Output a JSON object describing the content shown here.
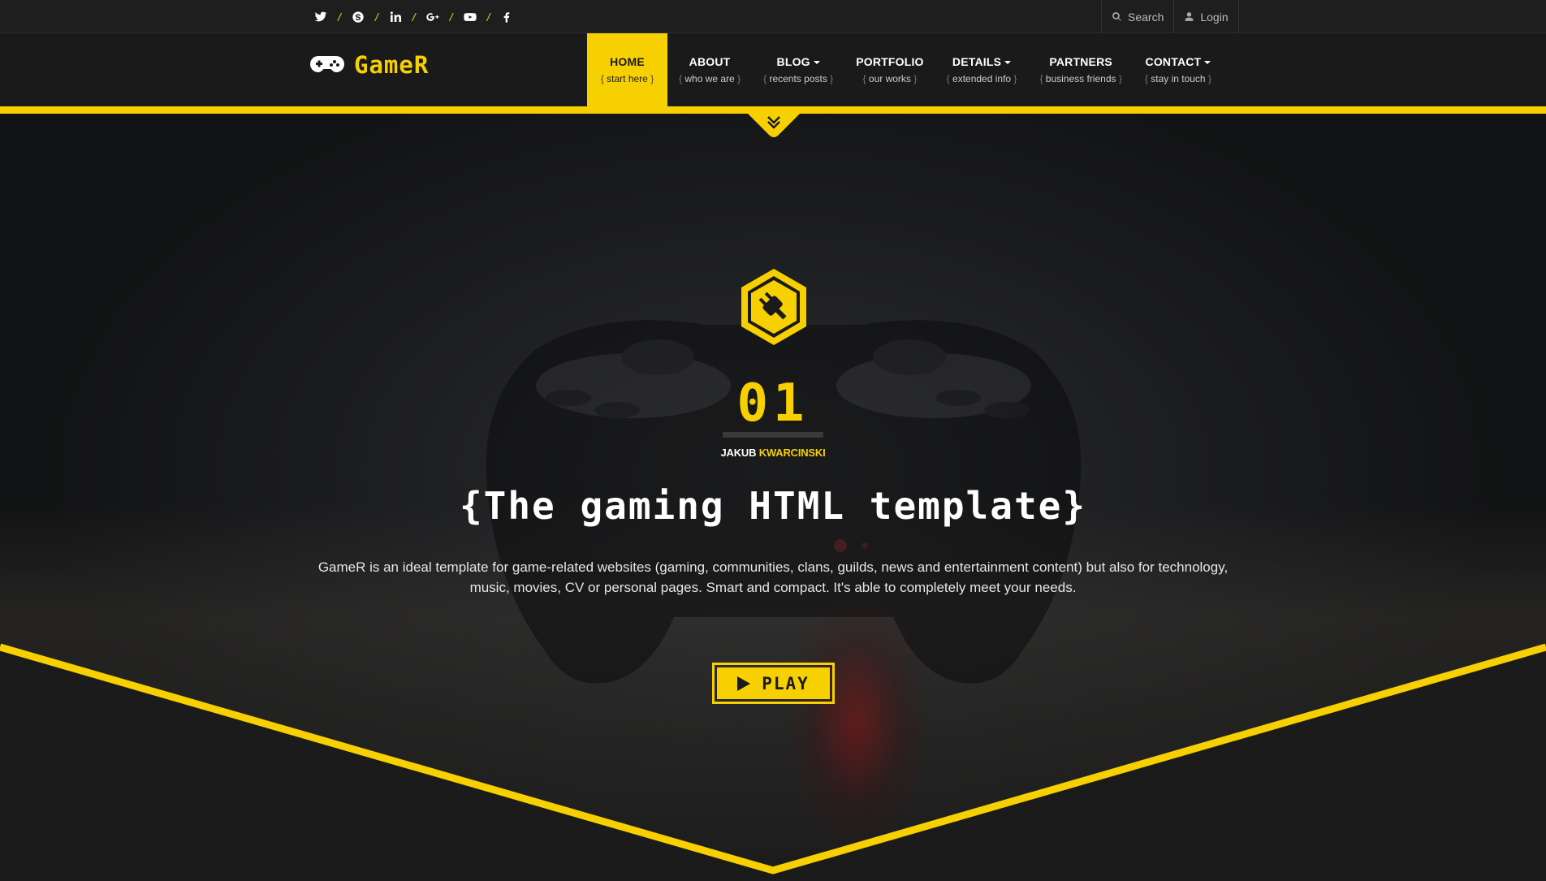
{
  "topbar": {
    "social_icons": [
      "twitter-icon",
      "skype-icon",
      "linkedin-icon",
      "google-plus-icon",
      "youtube-icon",
      "facebook-icon"
    ],
    "separator": "/",
    "search_label": "Search",
    "login_label": "Login"
  },
  "logo": {
    "text_main": "Game",
    "text_end": "R"
  },
  "nav": {
    "items": [
      {
        "label": "HOME",
        "sub": "start here",
        "active": true,
        "dropdown": false
      },
      {
        "label": "ABOUT",
        "sub": "who we are",
        "active": false,
        "dropdown": false
      },
      {
        "label": "BLOG",
        "sub": "recents posts",
        "active": false,
        "dropdown": true
      },
      {
        "label": "PORTFOLIO",
        "sub": "our works",
        "active": false,
        "dropdown": false
      },
      {
        "label": "DETAILS",
        "sub": "extended info",
        "active": false,
        "dropdown": true
      },
      {
        "label": "PARTNERS",
        "sub": "business friends",
        "active": false,
        "dropdown": false
      },
      {
        "label": "CONTACT",
        "sub": "stay in touch",
        "active": false,
        "dropdown": true
      }
    ],
    "bracket_open": "{",
    "bracket_close": "}"
  },
  "hero": {
    "badge_icon": "plug-icon",
    "number": "01",
    "author_first": "JAKUB",
    "author_last": "KWARCINSKI",
    "title": "{The gaming HTML template}",
    "description": "GameR is an ideal template for game-related websites (gaming, communities, clans, guilds, news and entertainment content) but also for technology, music, movies, CV or personal pages. Smart and compact. It's able to completely meet your needs.",
    "play_label": "PLAY"
  },
  "colors": {
    "accent": "#f6d000",
    "background": "#1c1c1c",
    "text": "#ffffff"
  }
}
